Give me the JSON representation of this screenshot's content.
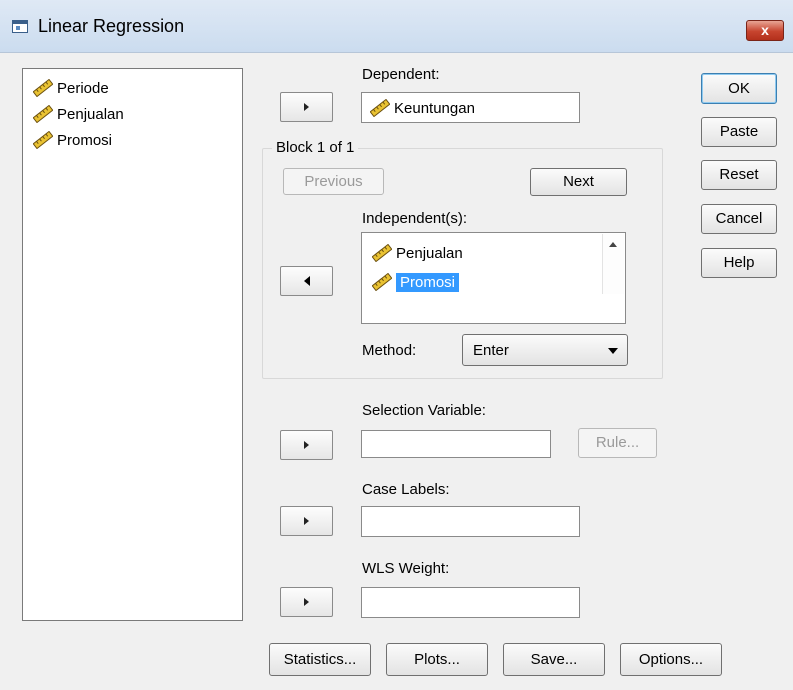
{
  "window": {
    "title": "Linear Regression",
    "close_label": "x"
  },
  "source_variables": [
    {
      "label": "Periode",
      "icon": "ruler-icon"
    },
    {
      "label": "Penjualan",
      "icon": "ruler-icon"
    },
    {
      "label": "Promosi",
      "icon": "ruler-icon"
    }
  ],
  "dependent": {
    "label": "Dependent:",
    "value": "Keuntungan"
  },
  "block": {
    "label": "Block 1 of 1",
    "previous_label": "Previous",
    "next_label": "Next",
    "independents_label": "Independent(s):",
    "independents": [
      {
        "label": "Penjualan",
        "selected": false
      },
      {
        "label": "Promosi",
        "selected": true
      }
    ],
    "method_label": "Method:",
    "method_value": "Enter"
  },
  "selection_variable": {
    "label": "Selection Variable:",
    "value": "",
    "rule_label": "Rule..."
  },
  "case_labels": {
    "label": "Case Labels:",
    "value": ""
  },
  "wls_weight": {
    "label": "WLS Weight:",
    "value": ""
  },
  "side_buttons": {
    "ok": "OK",
    "paste": "Paste",
    "reset": "Reset",
    "cancel": "Cancel",
    "help": "Help"
  },
  "bottom_buttons": {
    "statistics": "Statistics...",
    "plots": "Plots...",
    "save": "Save...",
    "options": "Options..."
  },
  "colors": {
    "selection": "#3399ff",
    "titlebar": "#cbdcef",
    "close": "#c7442e"
  }
}
